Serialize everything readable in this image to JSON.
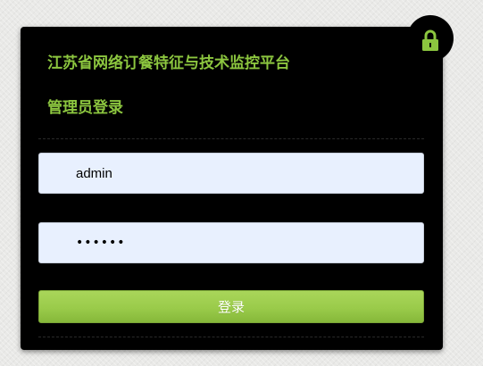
{
  "panel": {
    "title": "江苏省网络订餐特征与技术监控平台",
    "subtitle": "管理员登录"
  },
  "form": {
    "username_value": "admin",
    "password_value": "••••••",
    "login_button_label": "登录"
  },
  "icons": {
    "lock": "lock-icon"
  },
  "colors": {
    "panel_background": "#000000",
    "accent_green": "#8cc63f",
    "button_green": "#9acb4a",
    "field_background": "#e8f0fe",
    "page_background": "#e9e9e7"
  }
}
